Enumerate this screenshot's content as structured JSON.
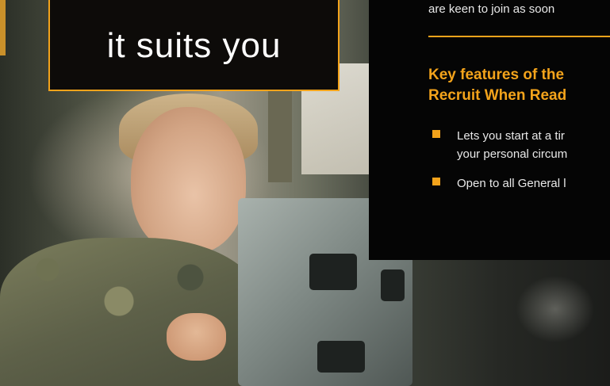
{
  "hero": {
    "image": "soldier-working-on-equipment-photo"
  },
  "headline": {
    "text": "it suits you"
  },
  "info": {
    "intro_line": "are keen to join as soon",
    "features_heading_line1": "Key features of the",
    "features_heading_line2": "Recruit When Read",
    "features": [
      {
        "line1": "Lets you start at a tir",
        "line2": "your personal circum"
      },
      {
        "line1": "Open to all General l"
      }
    ]
  },
  "colors": {
    "accent": "#f3a31b",
    "panel_bg": "#050505",
    "text_light": "#e8e8e8"
  }
}
